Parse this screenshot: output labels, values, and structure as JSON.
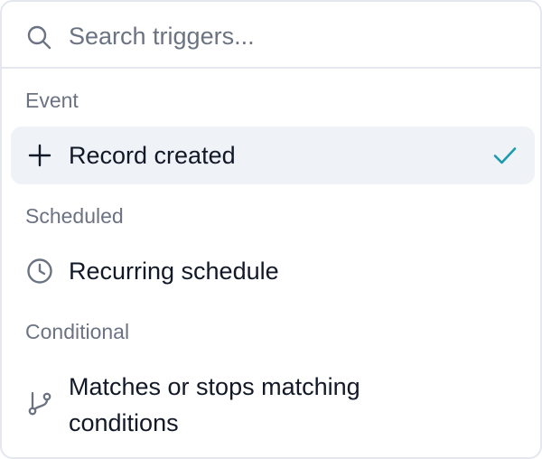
{
  "search": {
    "placeholder": "Search triggers..."
  },
  "groups": [
    {
      "label": "Event",
      "items": [
        {
          "label": "Record created",
          "icon": "plus-icon",
          "selected": true
        }
      ]
    },
    {
      "label": "Scheduled",
      "items": [
        {
          "label": "Recurring schedule",
          "icon": "clock-icon",
          "selected": false
        }
      ]
    },
    {
      "label": "Conditional",
      "items": [
        {
          "label": "Matches or stops matching conditions",
          "icon": "branch-icon",
          "selected": false
        }
      ]
    }
  ],
  "colors": {
    "accent_check": "#1a9bb0",
    "selected_bg": "#eff2f6",
    "muted_text": "#6b7383",
    "border": "#e4e8ee"
  }
}
